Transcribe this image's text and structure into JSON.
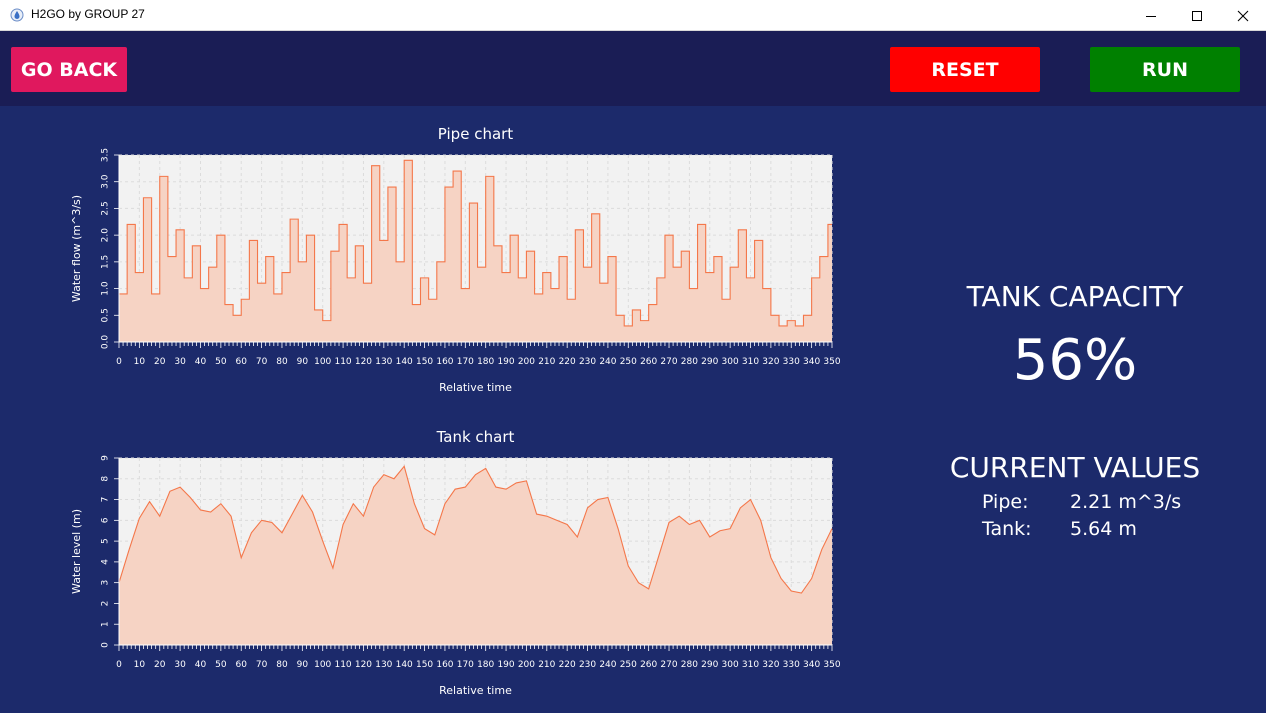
{
  "window": {
    "title": "H2GO by GROUP 27",
    "icon": "water-drop-icon"
  },
  "toolbar": {
    "go_back_label": "GO BACK",
    "reset_label": "RESET",
    "run_label": "RUN"
  },
  "colors": {
    "go_back": "#e0185e",
    "reset": "#ff0000",
    "run": "#008000",
    "series_line": "#f4774a",
    "series_fill": "#f6d3c4",
    "plot_bg": "#f2f2f2",
    "background": "#1c2a6b",
    "topbar": "#1a1d55"
  },
  "tank_capacity": {
    "label": "TANK CAPACITY",
    "value": "56%",
    "fraction": 0.56
  },
  "current_values": {
    "label": "CURRENT VALUES",
    "pipe_label": "Pipe:",
    "pipe_value": "2.21 m^3/s",
    "tank_label": "Tank:",
    "tank_value": "5.64 m"
  },
  "chart_data": [
    {
      "type": "area",
      "title": "Pipe chart",
      "xlabel": "Relative time",
      "ylabel": "Water flow (m^3/s)",
      "xlim": [
        0,
        350
      ],
      "ylim": [
        0,
        3.5
      ],
      "xticks": [
        0,
        10,
        20,
        30,
        40,
        50,
        60,
        70,
        80,
        90,
        100,
        110,
        120,
        130,
        140,
        150,
        160,
        170,
        180,
        190,
        200,
        210,
        220,
        230,
        240,
        250,
        260,
        270,
        280,
        290,
        300,
        310,
        320,
        330,
        340,
        350
      ],
      "yticks": [
        "0.0",
        "0.5",
        "1.0",
        "1.5",
        "2.0",
        "2.5",
        "3.0",
        "3.5"
      ],
      "step": true,
      "grid": true,
      "x": [
        0,
        4,
        8,
        12,
        16,
        20,
        24,
        28,
        32,
        36,
        40,
        44,
        48,
        52,
        56,
        60,
        64,
        68,
        72,
        76,
        80,
        84,
        88,
        92,
        96,
        100,
        104,
        108,
        112,
        116,
        120,
        124,
        128,
        132,
        136,
        140,
        144,
        148,
        152,
        156,
        160,
        164,
        168,
        172,
        176,
        180,
        184,
        188,
        192,
        196,
        200,
        204,
        208,
        212,
        216,
        220,
        224,
        228,
        232,
        236,
        240,
        244,
        248,
        252,
        256,
        260,
        264,
        268,
        272,
        276,
        280,
        284,
        288,
        292,
        296,
        300,
        304,
        308,
        312,
        316,
        320,
        324,
        328,
        332,
        336,
        340,
        344,
        348,
        350
      ],
      "values": [
        0.9,
        2.2,
        1.3,
        2.7,
        0.9,
        3.1,
        1.6,
        2.1,
        1.2,
        1.8,
        1.0,
        1.4,
        2.0,
        0.7,
        0.5,
        0.8,
        1.9,
        1.1,
        1.6,
        0.9,
        1.3,
        2.3,
        1.5,
        2.0,
        0.6,
        0.4,
        1.7,
        2.2,
        1.2,
        1.8,
        1.1,
        3.3,
        1.9,
        2.9,
        1.5,
        3.4,
        0.7,
        1.2,
        0.8,
        1.5,
        2.9,
        3.2,
        1.0,
        2.6,
        1.4,
        3.1,
        1.8,
        1.3,
        2.0,
        1.2,
        1.7,
        0.9,
        1.3,
        1.0,
        1.6,
        0.8,
        2.1,
        1.4,
        2.4,
        1.1,
        1.6,
        0.5,
        0.3,
        0.6,
        0.4,
        0.7,
        1.2,
        2.0,
        1.4,
        1.7,
        1.0,
        2.2,
        1.3,
        1.6,
        0.8,
        1.4,
        2.1,
        1.2,
        1.9,
        1.0,
        0.5,
        0.3,
        0.4,
        0.3,
        0.5,
        1.2,
        1.6,
        2.2,
        2.2
      ]
    },
    {
      "type": "area",
      "title": "Tank chart",
      "xlabel": "Relative time",
      "ylabel": "Water level (m)",
      "xlim": [
        0,
        350
      ],
      "ylim": [
        0,
        9
      ],
      "xticks": [
        0,
        10,
        20,
        30,
        40,
        50,
        60,
        70,
        80,
        90,
        100,
        110,
        120,
        130,
        140,
        150,
        160,
        170,
        180,
        190,
        200,
        210,
        220,
        230,
        240,
        250,
        260,
        270,
        280,
        290,
        300,
        310,
        320,
        330,
        340,
        350
      ],
      "yticks": [
        "0",
        "1",
        "2",
        "3",
        "4",
        "5",
        "6",
        "7",
        "8",
        "9"
      ],
      "step": false,
      "grid": true,
      "x": [
        0,
        5,
        10,
        15,
        20,
        25,
        30,
        35,
        40,
        45,
        50,
        55,
        60,
        65,
        70,
        75,
        80,
        85,
        90,
        95,
        100,
        105,
        110,
        115,
        120,
        125,
        130,
        135,
        140,
        145,
        150,
        155,
        160,
        165,
        170,
        175,
        180,
        185,
        190,
        195,
        200,
        205,
        210,
        215,
        220,
        225,
        230,
        235,
        240,
        245,
        250,
        255,
        260,
        265,
        270,
        275,
        280,
        285,
        290,
        295,
        300,
        305,
        310,
        315,
        320,
        325,
        330,
        335,
        340,
        345,
        350
      ],
      "values": [
        3.0,
        4.6,
        6.1,
        6.9,
        6.2,
        7.4,
        7.6,
        7.1,
        6.5,
        6.4,
        6.8,
        6.2,
        4.2,
        5.4,
        6.0,
        5.9,
        5.4,
        6.3,
        7.2,
        6.4,
        5.0,
        3.7,
        5.8,
        6.8,
        6.2,
        7.6,
        8.2,
        8.0,
        8.6,
        6.8,
        5.6,
        5.3,
        6.8,
        7.5,
        7.6,
        8.2,
        8.5,
        7.6,
        7.5,
        7.8,
        7.9,
        6.3,
        6.2,
        6.0,
        5.8,
        5.2,
        6.6,
        7.0,
        7.1,
        5.6,
        3.8,
        3.0,
        2.7,
        4.3,
        5.9,
        6.2,
        5.8,
        6.0,
        5.2,
        5.5,
        5.6,
        6.6,
        7.0,
        6.0,
        4.2,
        3.2,
        2.6,
        2.5,
        3.2,
        4.6,
        5.6
      ]
    }
  ]
}
